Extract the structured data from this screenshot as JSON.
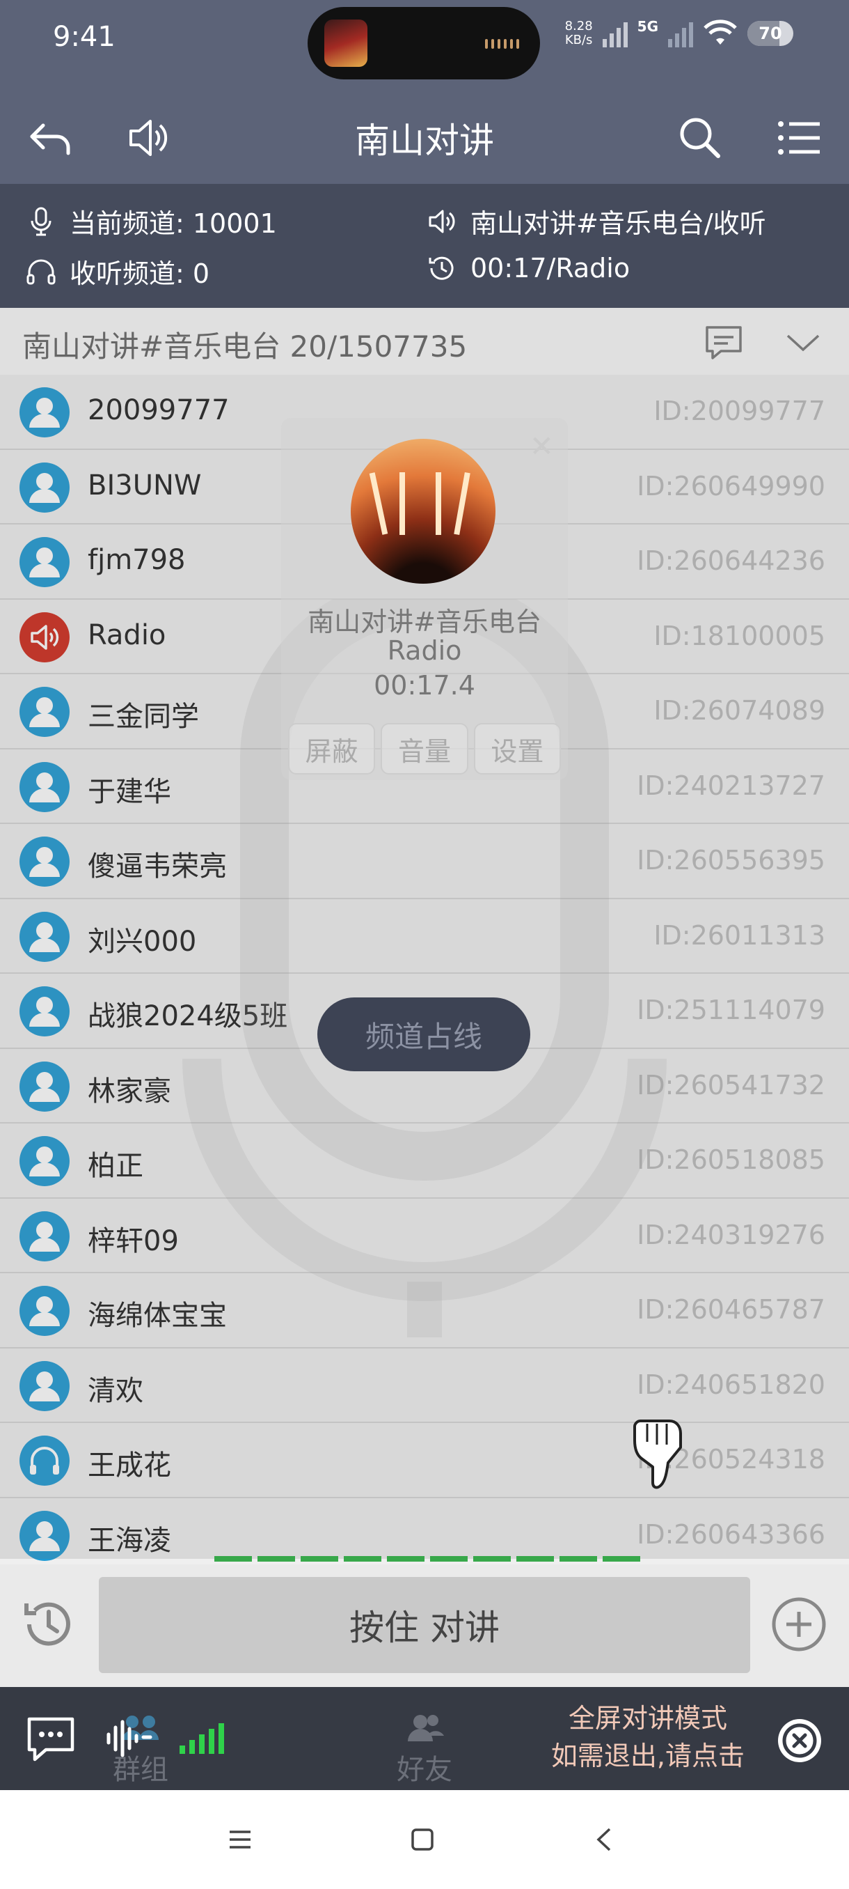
{
  "status_bar": {
    "time": "9:41",
    "net_speed_value": "8.28",
    "net_speed_unit": "KB/s",
    "network": "5G",
    "battery": "70"
  },
  "app_bar": {
    "title": "南山对讲",
    "back_icon": "back-arrow-icon",
    "speaker_icon": "speaker-icon",
    "search_icon": "search-icon",
    "menu_icon": "list-menu-icon"
  },
  "info_panel": {
    "current_channel": "当前频道: 10001",
    "listen_channel": "收听频道: 0",
    "now_playing": "南山对讲#音乐电台/收听",
    "elapsed": "00:17/Radio"
  },
  "channel_header": {
    "title": "南山对讲#音乐电台 20/1507735"
  },
  "members": [
    {
      "name": "20099777",
      "id": "ID:20099777",
      "avatar": "person"
    },
    {
      "name": "BI3UNW",
      "id": "ID:260649990",
      "avatar": "person"
    },
    {
      "name": "fjm798",
      "id": "ID:260644236",
      "avatar": "person"
    },
    {
      "name": "Radio",
      "id": "ID:18100005",
      "avatar": "radio"
    },
    {
      "name": "三金同学",
      "id": "ID:26074089",
      "avatar": "person"
    },
    {
      "name": "于建华",
      "id": "ID:240213727",
      "avatar": "person"
    },
    {
      "name": "傻逼韦荣亮",
      "id": "ID:260556395",
      "avatar": "person"
    },
    {
      "name": "刘兴000",
      "id": "ID:26011313",
      "avatar": "person"
    },
    {
      "name": "战狼2024级5班",
      "id": "ID:251114079",
      "avatar": "person"
    },
    {
      "name": "林家豪",
      "id": "ID:260541732",
      "avatar": "person"
    },
    {
      "name": "柏正",
      "id": "ID:260518085",
      "avatar": "person"
    },
    {
      "name": "梓轩09",
      "id": "ID:240319276",
      "avatar": "person"
    },
    {
      "name": "海绵体宝宝",
      "id": "ID:260465787",
      "avatar": "person"
    },
    {
      "name": "清欢",
      "id": "ID:240651820",
      "avatar": "person"
    },
    {
      "name": "王成花",
      "id": "ID:260524318",
      "avatar": "headset"
    },
    {
      "name": "王海凌",
      "id": "ID:260643366",
      "avatar": "person"
    }
  ],
  "radio_card": {
    "channel": "南山对讲#音乐电台",
    "speaker": "Radio",
    "time": "00:17.4",
    "buttons": [
      "屏蔽",
      "音量",
      "设置"
    ]
  },
  "occupied_label": "频道占线",
  "ptt": {
    "label": "按住 对讲"
  },
  "bottom_nav": {
    "groups": "群组",
    "friends": "好友",
    "fullscreen_line1": "全屏对讲模式",
    "fullscreen_line2": "如需退出,请点击"
  },
  "colors": {
    "header_bg": "#5c6378",
    "info_bg": "#454b5c",
    "avatar_blue": "#1f9ad4",
    "radio_red": "#d02a1c",
    "level_green": "#37a84a"
  }
}
